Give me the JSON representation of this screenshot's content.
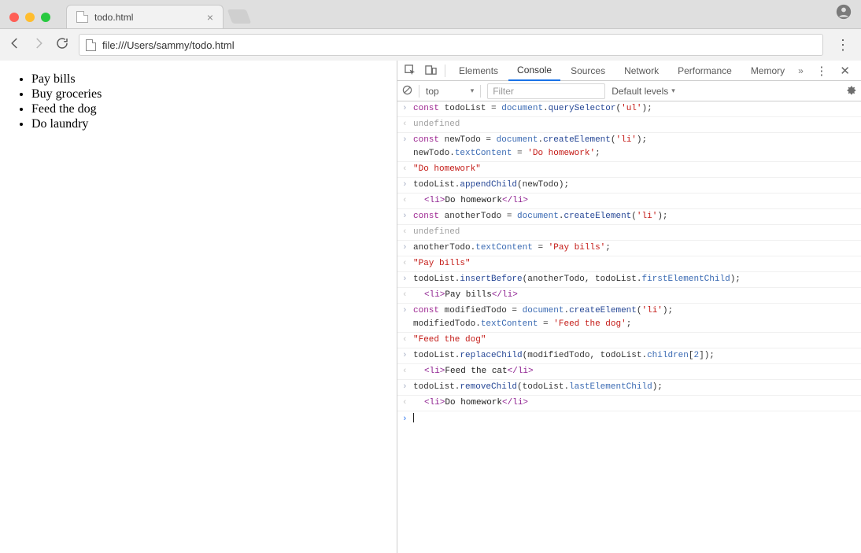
{
  "browser": {
    "tab_title": "todo.html",
    "url": "file:///Users/sammy/todo.html"
  },
  "page": {
    "items": [
      "Pay bills",
      "Buy groceries",
      "Feed the dog",
      "Do laundry"
    ]
  },
  "devtools": {
    "tabs": [
      "Elements",
      "Console",
      "Sources",
      "Network",
      "Performance",
      "Memory"
    ],
    "active_tab": "Console",
    "context": "top",
    "filter_placeholder": "Filter",
    "levels_label": "Default levels"
  },
  "console": {
    "entries": [
      {
        "type": "in",
        "code": [
          {
            "t": "kw",
            "v": "const"
          },
          {
            "t": "txt",
            "v": " todoList = "
          },
          {
            "t": "prop",
            "v": "document"
          },
          {
            "t": "txt",
            "v": "."
          },
          {
            "t": "fn",
            "v": "querySelector"
          },
          {
            "t": "txt",
            "v": "("
          },
          {
            "t": "str",
            "v": "'ul'"
          },
          {
            "t": "txt",
            "v": ");"
          }
        ]
      },
      {
        "type": "out",
        "code": [
          {
            "t": "und",
            "v": "undefined"
          }
        ]
      },
      {
        "type": "in",
        "code": [
          {
            "t": "kw",
            "v": "const"
          },
          {
            "t": "txt",
            "v": " newTodo = "
          },
          {
            "t": "prop",
            "v": "document"
          },
          {
            "t": "txt",
            "v": "."
          },
          {
            "t": "fn",
            "v": "createElement"
          },
          {
            "t": "txt",
            "v": "("
          },
          {
            "t": "str",
            "v": "'li'"
          },
          {
            "t": "txt",
            "v": ");\nnewTodo."
          },
          {
            "t": "prop",
            "v": "textContent"
          },
          {
            "t": "txt",
            "v": " = "
          },
          {
            "t": "str",
            "v": "'Do homework'"
          },
          {
            "t": "txt",
            "v": ";"
          }
        ]
      },
      {
        "type": "out",
        "code": [
          {
            "t": "res-str",
            "v": "\"Do homework\""
          }
        ]
      },
      {
        "type": "in",
        "code": [
          {
            "t": "txt",
            "v": "todoList."
          },
          {
            "t": "fn",
            "v": "appendChild"
          },
          {
            "t": "txt",
            "v": "(newTodo);"
          }
        ]
      },
      {
        "type": "out",
        "indent": true,
        "code": [
          {
            "t": "htag",
            "v": "<li>"
          },
          {
            "t": "hcontent",
            "v": "Do homework"
          },
          {
            "t": "htag",
            "v": "</li>"
          }
        ]
      },
      {
        "type": "in",
        "code": [
          {
            "t": "kw",
            "v": "const"
          },
          {
            "t": "txt",
            "v": " anotherTodo = "
          },
          {
            "t": "prop",
            "v": "document"
          },
          {
            "t": "txt",
            "v": "."
          },
          {
            "t": "fn",
            "v": "createElement"
          },
          {
            "t": "txt",
            "v": "("
          },
          {
            "t": "str",
            "v": "'li'"
          },
          {
            "t": "txt",
            "v": ");"
          }
        ]
      },
      {
        "type": "out",
        "code": [
          {
            "t": "und",
            "v": "undefined"
          }
        ]
      },
      {
        "type": "in",
        "code": [
          {
            "t": "txt",
            "v": "anotherTodo."
          },
          {
            "t": "prop",
            "v": "textContent"
          },
          {
            "t": "txt",
            "v": " = "
          },
          {
            "t": "str",
            "v": "'Pay bills'"
          },
          {
            "t": "txt",
            "v": ";"
          }
        ]
      },
      {
        "type": "out",
        "code": [
          {
            "t": "res-str",
            "v": "\"Pay bills\""
          }
        ]
      },
      {
        "type": "in",
        "code": [
          {
            "t": "txt",
            "v": "todoList."
          },
          {
            "t": "fn",
            "v": "insertBefore"
          },
          {
            "t": "txt",
            "v": "(anotherTodo, todoList."
          },
          {
            "t": "prop",
            "v": "firstElementChild"
          },
          {
            "t": "txt",
            "v": ");"
          }
        ]
      },
      {
        "type": "out",
        "indent": true,
        "code": [
          {
            "t": "htag",
            "v": "<li>"
          },
          {
            "t": "hcontent",
            "v": "Pay bills"
          },
          {
            "t": "htag",
            "v": "</li>"
          }
        ]
      },
      {
        "type": "in",
        "code": [
          {
            "t": "kw",
            "v": "const"
          },
          {
            "t": "txt",
            "v": " modifiedTodo = "
          },
          {
            "t": "prop",
            "v": "document"
          },
          {
            "t": "txt",
            "v": "."
          },
          {
            "t": "fn",
            "v": "createElement"
          },
          {
            "t": "txt",
            "v": "("
          },
          {
            "t": "str",
            "v": "'li'"
          },
          {
            "t": "txt",
            "v": ");\nmodifiedTodo."
          },
          {
            "t": "prop",
            "v": "textContent"
          },
          {
            "t": "txt",
            "v": " = "
          },
          {
            "t": "str",
            "v": "'Feed the dog'"
          },
          {
            "t": "txt",
            "v": ";"
          }
        ]
      },
      {
        "type": "out",
        "code": [
          {
            "t": "res-str",
            "v": "\"Feed the dog\""
          }
        ]
      },
      {
        "type": "in",
        "code": [
          {
            "t": "txt",
            "v": "todoList."
          },
          {
            "t": "fn",
            "v": "replaceChild"
          },
          {
            "t": "txt",
            "v": "(modifiedTodo, todoList."
          },
          {
            "t": "prop",
            "v": "children"
          },
          {
            "t": "txt",
            "v": "["
          },
          {
            "t": "prop",
            "v": "2"
          },
          {
            "t": "txt",
            "v": "]);"
          }
        ]
      },
      {
        "type": "out",
        "indent": true,
        "code": [
          {
            "t": "htag",
            "v": "<li>"
          },
          {
            "t": "hcontent",
            "v": "Feed the cat"
          },
          {
            "t": "htag",
            "v": "</li>"
          }
        ]
      },
      {
        "type": "in",
        "code": [
          {
            "t": "txt",
            "v": "todoList."
          },
          {
            "t": "fn",
            "v": "removeChild"
          },
          {
            "t": "txt",
            "v": "(todoList."
          },
          {
            "t": "prop",
            "v": "lastElementChild"
          },
          {
            "t": "txt",
            "v": ");"
          }
        ]
      },
      {
        "type": "out",
        "indent": true,
        "code": [
          {
            "t": "htag",
            "v": "<li>"
          },
          {
            "t": "hcontent",
            "v": "Do homework"
          },
          {
            "t": "htag",
            "v": "</li>"
          }
        ]
      }
    ]
  }
}
